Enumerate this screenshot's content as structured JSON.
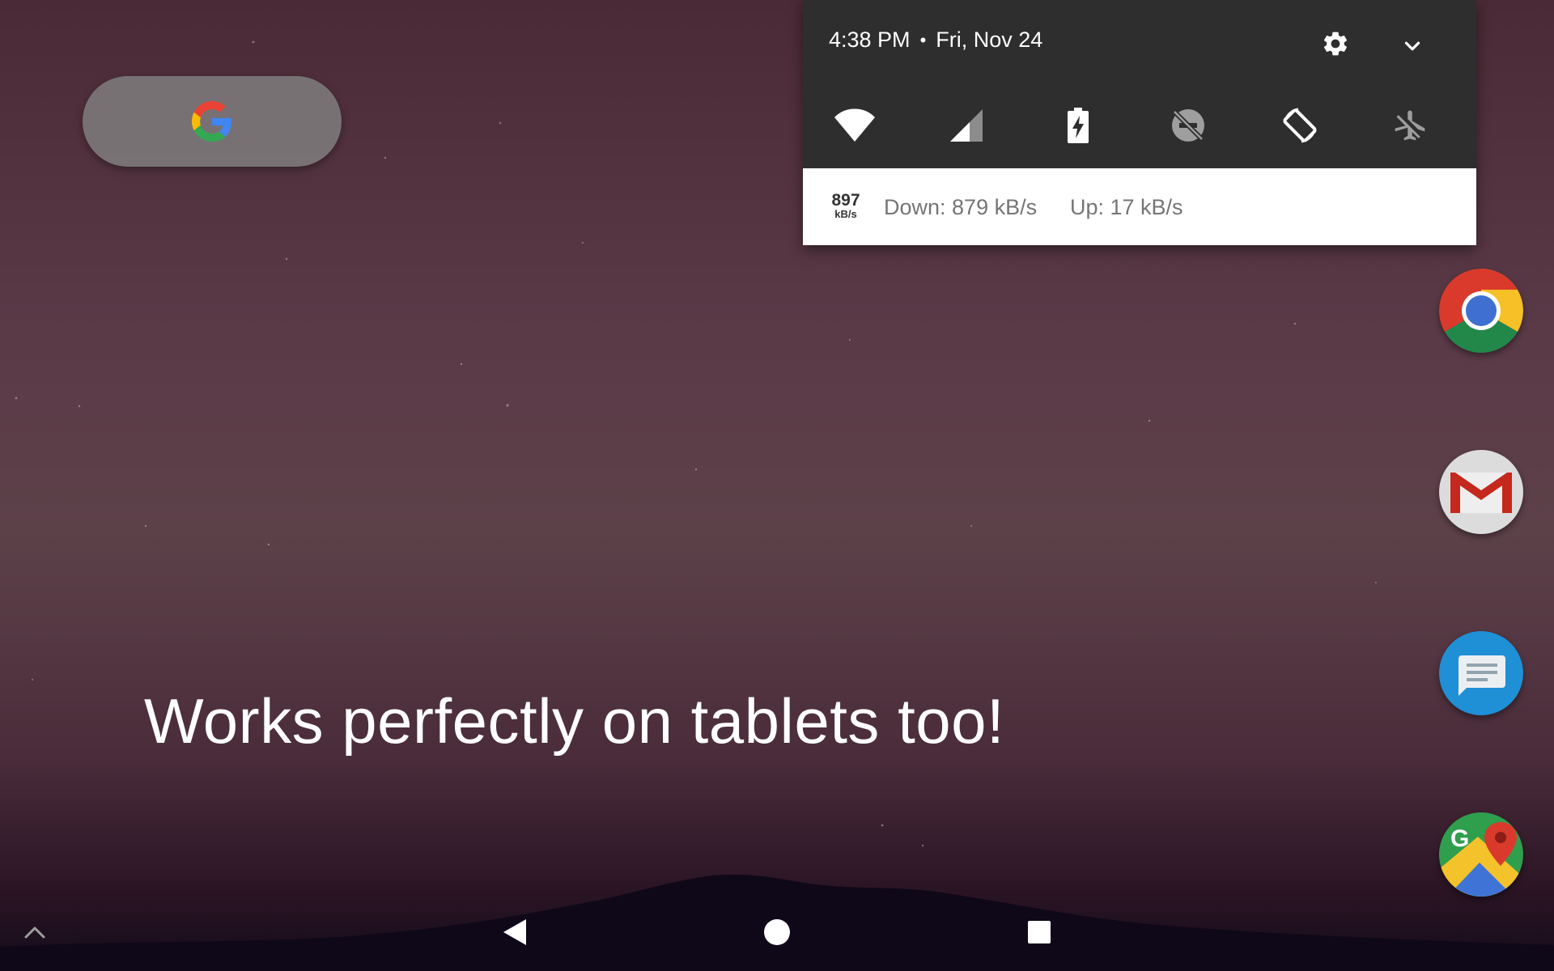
{
  "status_bar": {
    "time": "4:38 PM",
    "separator": "•",
    "date": "Fri, Nov 24",
    "settings_icon": "gear-icon",
    "expand_icon": "chevron-down-icon"
  },
  "quick_settings": {
    "tiles": [
      {
        "icon": "wifi-icon",
        "state": "on"
      },
      {
        "icon": "cellular-signal-icon",
        "state": "on"
      },
      {
        "icon": "battery-charging-icon",
        "state": "on"
      },
      {
        "icon": "do-not-disturb-off-icon",
        "state": "off"
      },
      {
        "icon": "auto-rotate-icon",
        "state": "on"
      },
      {
        "icon": "airplane-mode-off-icon",
        "state": "off"
      }
    ]
  },
  "notification": {
    "speed_value": "897",
    "speed_unit": "kB/s",
    "down": "Down: 879 kB/s",
    "up": "Up: 17 kB/s"
  },
  "home": {
    "search_widget_icon": "google-g-icon",
    "headline": "Works perfectly on tablets too!"
  },
  "dock": [
    {
      "app": "Chrome",
      "icon": "chrome-icon"
    },
    {
      "app": "Gmail",
      "icon": "gmail-icon"
    },
    {
      "app": "Messages",
      "icon": "messages-icon"
    },
    {
      "app": "Maps",
      "icon": "maps-icon"
    }
  ],
  "nav_bar": {
    "buttons": [
      "back-icon",
      "home-icon",
      "recents-icon"
    ],
    "app_drawer_icon": "chevron-up-icon"
  },
  "colors": {
    "shade_dark": "#2e2e2e",
    "notification_bg": "#ffffff",
    "notification_text": "#757575",
    "search_pill": "#808080"
  }
}
